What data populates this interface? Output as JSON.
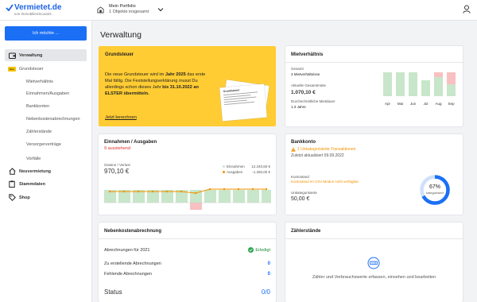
{
  "header": {
    "logo_text": "Vermietet.de",
    "logo_subtext": "von ImmobilienScout24",
    "portfolio_title": "Mein Portfolio",
    "portfolio_subtitle": "1 Objekte insgesamt"
  },
  "sidebar": {
    "cta_label": "Ich möchte ...",
    "items": [
      {
        "label": "Verwaltung"
      },
      {
        "label": "Grundsteuer",
        "badge": "Neu"
      },
      {
        "label": "Mietverhältnis"
      },
      {
        "label": "Einnahmen/Ausgaben"
      },
      {
        "label": "Bankkonten"
      },
      {
        "label": "Nebenkostenabrechnungen"
      },
      {
        "label": "Zählerstände"
      },
      {
        "label": "Versorgerverträge"
      },
      {
        "label": "Vorfälle"
      },
      {
        "label": "Neuvermietung"
      },
      {
        "label": "Stammdaten"
      },
      {
        "label": "Shop"
      }
    ]
  },
  "main": {
    "title": "Verwaltung"
  },
  "grundsteuer": {
    "title": "Grundsteuer",
    "text_part1": "Die neue Grundsteuer wird im ",
    "text_bold1": "Jahr 2025",
    "text_part2": " das erste Mal fällig. Die Feststellungserklärung musst Du allerdings schon dieses Jahr ",
    "text_bold2": "bis 31.10.2022 an ELSTER übermitteln.",
    "link": "Jetzt berechnen",
    "doc_title": "Grundsteuer"
  },
  "mietverhaeltnis": {
    "title": "Mietverhältnis",
    "gesamt_label": "Gesamt",
    "gesamt_value": "3 Mietverhältnisse",
    "miete_label": "Aktuelle Gesamtmiete",
    "miete_value": "1.070,10 €",
    "dauer_label": "Durchschnittliche Mietdauer",
    "dauer_value": "1.3 Jahre",
    "chart_months": [
      "Apr",
      "Mai",
      "Jun",
      "Jul",
      "Aug",
      "Sep"
    ],
    "chart_colors": {
      "paid": "#c8e6c9",
      "unpaid": "#f8c0c0"
    }
  },
  "einnahmen": {
    "title": "Einnahmen / Ausgaben",
    "status": "9 ausstehend",
    "gewinn_label": "Gewinn / Verlust",
    "gewinn_value": "970,10 €",
    "legend_income_label": "Einnahmen",
    "legend_income_value": "12.240,60 €",
    "legend_expense_label": "Ausgaben",
    "legend_expense_value": "-1.250,00 €",
    "colors": {
      "income": "#c8e6c9",
      "expense": "#f8c0c0",
      "line": "#f39200"
    }
  },
  "bankkonto": {
    "title": "Bankkonto",
    "warning": "1 Unkategorisierte Transaktionen",
    "updated": "Zuletzt aktualisiert 09.09.2022",
    "kontostand_label": "Kontostand",
    "kontostand_note": "Kontostand im CSV-Modus nicht verfügbar",
    "unkat_label": "Unkategorisierte",
    "unkat_value": "50,00 €",
    "progress_value": "67%",
    "progress_fraction": 0.67,
    "progress_label": "kategorisiert",
    "colors": {
      "ring": "#1b6ff5",
      "track": "#cfe0fb"
    }
  },
  "nebenkosten": {
    "title": "Nebenkostenabrechnung",
    "year_label": "Abrechnungen für 2021",
    "year_status": "Erledigt",
    "row1_label": "Zu erstellende Abrechnungen",
    "row1_value": "0",
    "row2_label": "Fehlende Abrechnungen",
    "row2_value": "0",
    "status_label": "Status",
    "status_value": "0/0"
  },
  "zaehler": {
    "title": "Zählerstände",
    "text": "Zähler und Verbrauchswerte erfassen, einsehen und bearbeiten"
  }
}
